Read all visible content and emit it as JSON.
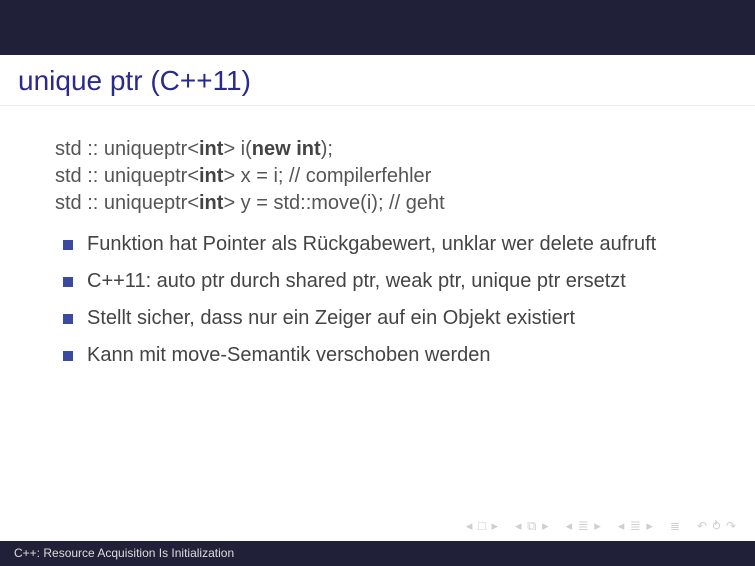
{
  "title": "unique ptr (C++11)",
  "code": {
    "l1_a": "std :: uniqueptr",
    "l1_b": "int",
    "l1_c": " i(",
    "l1_d": "new int",
    "l1_e": ");",
    "l2_a": "std :: uniqueptr",
    "l2_b": "int",
    "l2_c": " x = i; // compilerfehler",
    "l3_a": "std :: uniqueptr",
    "l3_b": "int",
    "l3_c": " y = std::move(i); // geht"
  },
  "bullets": [
    "Funktion hat Pointer als Rückgabewert, unklar wer delete aufruft",
    "C++11: auto ptr durch shared ptr, weak ptr, unique ptr ersetzt",
    "Stellt sicher, dass nur ein Zeiger auf ein Objekt existiert",
    "Kann mit move-Semantik verschoben werden"
  ],
  "footer": "C++: Resource Acquisition Is Initialization",
  "nav": {
    "back1": "◂ □ ▸",
    "back2": "◂ ⧉ ▸",
    "back3": "◂ ≣ ▸",
    "back4": "◂ ≣ ▸",
    "mode": "≣",
    "loop": "↶ ⥁ ↷"
  }
}
